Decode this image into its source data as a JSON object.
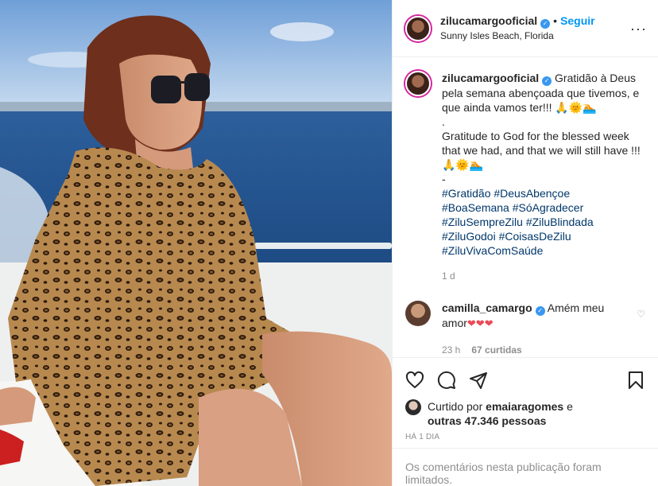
{
  "post": {
    "author": "zilucamargooficial",
    "dot": "•",
    "follow_label": "Seguir",
    "location": "Sunny Isles Beach, Florida",
    "more_label": "···"
  },
  "caption": {
    "username": "zilucamargooficial",
    "lines": [
      "Gratidão à Deus pela semana abençoada que tivemos, e que ainda vamos ter!!! 🙏🌞🏊",
      ".",
      "Gratitude to God for the blessed week that we had, and that we will still have !!! 🙏🌞🏊",
      "-"
    ],
    "hashtags": [
      "#Gratidão #DeusAbençoe",
      "#BoaSemana #SóAgradecer",
      "#ZiluSempreZilu #ZiluBlindada",
      "#ZiluGodoi #CoisasDeZilu",
      "#ZiluVivaComSaúde"
    ],
    "time": "1 d"
  },
  "comment": {
    "username": "camilla_camargo",
    "text": "Amém meu amor",
    "hearts": "❤❤❤",
    "time": "23 h",
    "likes": "67 curtidas"
  },
  "likes": {
    "prefix": "Curtido por",
    "user": "emaiaragomes",
    "connector": "e",
    "others": "outras 47.346 pessoas"
  },
  "posted_ago": "HÁ 1 DIA",
  "comments_limited": "Os comentários nesta publicação foram limitados.",
  "colors": {
    "follow_blue": "#0095f6",
    "hashtag": "#00376b",
    "meta_gray": "#8e8e8e",
    "heart_red": "#ed4956"
  }
}
